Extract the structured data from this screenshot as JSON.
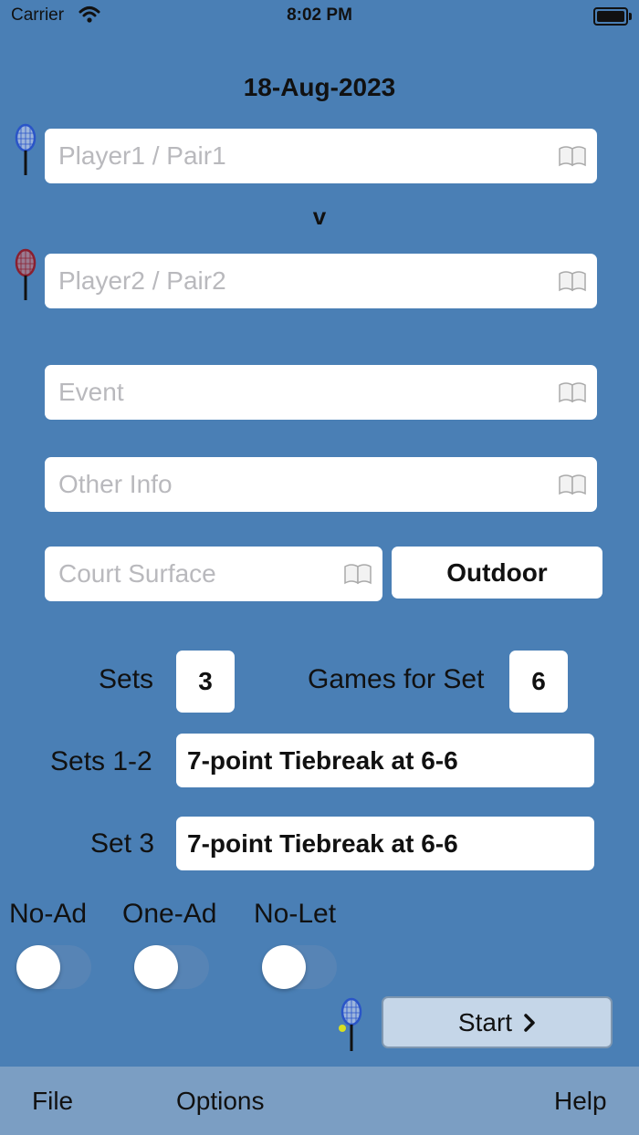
{
  "status": {
    "carrier": "Carrier",
    "time": "8:02 PM"
  },
  "match": {
    "date": "18-Aug-2023",
    "versus": "v"
  },
  "fields": {
    "player1_placeholder": "Player1 / Pair1",
    "player2_placeholder": "Player2 / Pair2",
    "event_placeholder": "Event",
    "other_info_placeholder": "Other Info",
    "court_surface_placeholder": "Court Surface"
  },
  "outdoor_label": "Outdoor",
  "settings": {
    "sets_label": "Sets",
    "sets_value": "3",
    "games_label": "Games for Set",
    "games_value": "6",
    "sets12_label": "Sets 1-2",
    "sets12_value": "7-point Tiebreak at 6-6",
    "set3_label": "Set 3",
    "set3_value": "7-point Tiebreak at 6-6"
  },
  "toggles": [
    {
      "label": "No-Ad",
      "on": false
    },
    {
      "label": "One-Ad",
      "on": false
    },
    {
      "label": "No-Let",
      "on": false
    }
  ],
  "start_label": "Start",
  "tabs": {
    "file": "File",
    "options": "Options",
    "help": "Help"
  },
  "colors": {
    "background": "#4a7fb5",
    "player1_racket": "#2a55c8",
    "player2_racket": "#8a2030",
    "tab_bar": "#7b9ec3"
  },
  "icons": [
    "wifi-icon",
    "battery-icon",
    "racket-icon",
    "book-icon",
    "chevron-right-icon",
    "tennis-ball-icon"
  ]
}
